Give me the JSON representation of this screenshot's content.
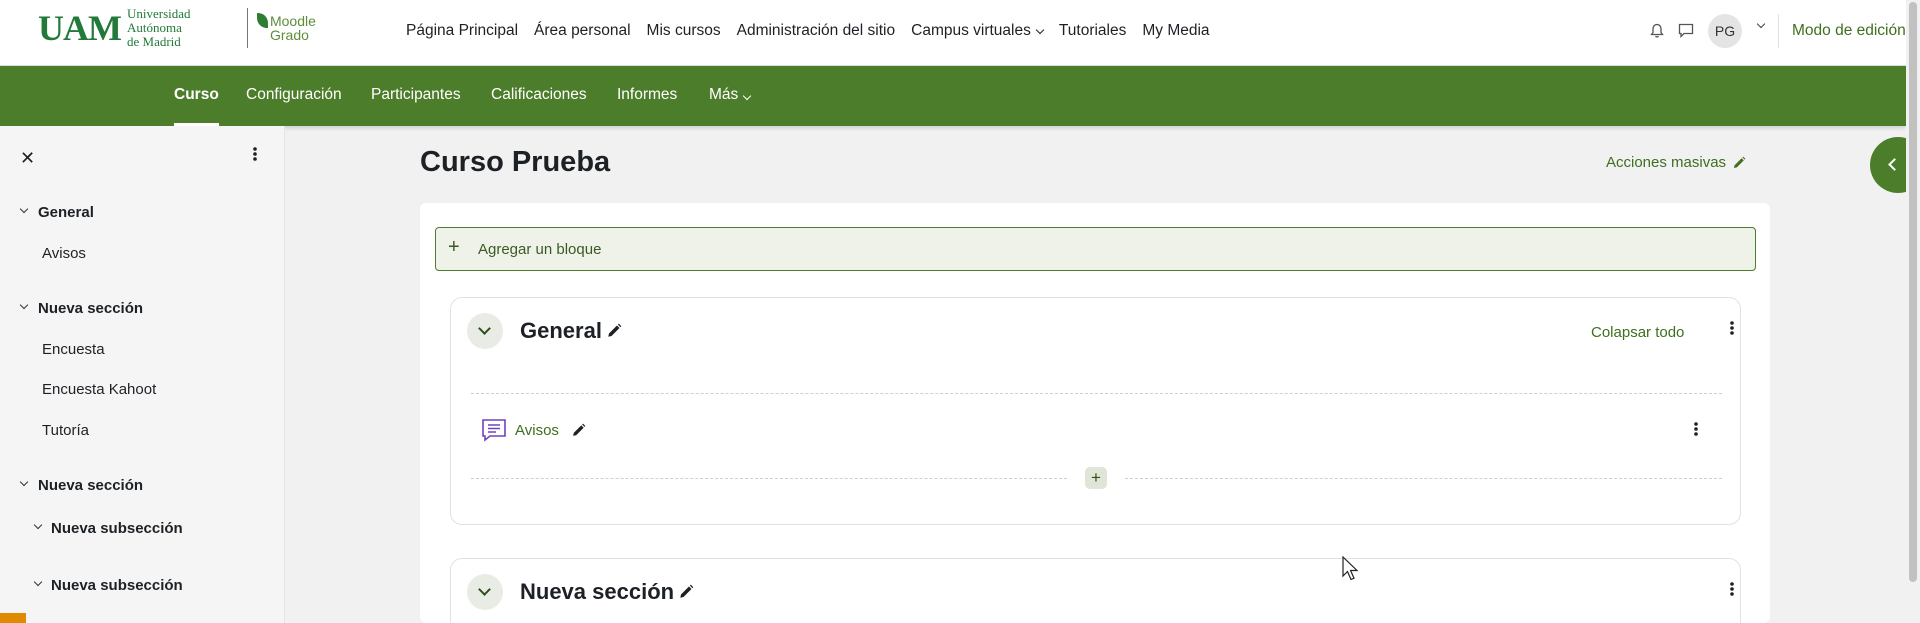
{
  "branding": {
    "uam_mark": "UAM",
    "uam_name_line1": "Universidad Autónoma",
    "uam_name_line2": "de Madrid",
    "moodle_line1": "Moodle",
    "moodle_line2": "Grado"
  },
  "primary_nav": {
    "items": [
      "Página Principal",
      "Área personal",
      "Mis cursos",
      "Administración del sitio",
      "Campus virtuales",
      "Tutoriales",
      "My Media"
    ]
  },
  "user": {
    "initials": "PG",
    "edit_mode_label": "Modo de edición",
    "edit_mode_on": true
  },
  "secondary_nav": {
    "tabs": [
      "Curso",
      "Configuración",
      "Participantes",
      "Calificaciones",
      "Informes",
      "Más"
    ],
    "active": "Curso"
  },
  "drawer": {
    "close_symbol": "✕",
    "sections": [
      {
        "title": "General",
        "items": [
          "Avisos"
        ]
      },
      {
        "title": "Nueva sección",
        "items": [
          "Encuesta",
          "Encuesta Kahoot",
          "Tutoría"
        ]
      },
      {
        "title": "Nueva sección",
        "subsections": [
          "Nueva subsección",
          "Nueva subsección"
        ]
      }
    ]
  },
  "main": {
    "page_title": "Curso Prueba",
    "bulk_actions": "Acciones masivas",
    "add_block": "Agregar un bloque",
    "sections": [
      {
        "name": "General",
        "collapse_all": "Colapsar todo",
        "activities": [
          {
            "name": "Avisos",
            "icon": "forum-icon"
          }
        ]
      },
      {
        "name": "Nueva sección"
      }
    ]
  },
  "colors": {
    "brand_green": "#4c7d2a",
    "link_green": "#3f6f1f",
    "uam_green": "#23793a",
    "forum_purple": "#6f42c1"
  }
}
